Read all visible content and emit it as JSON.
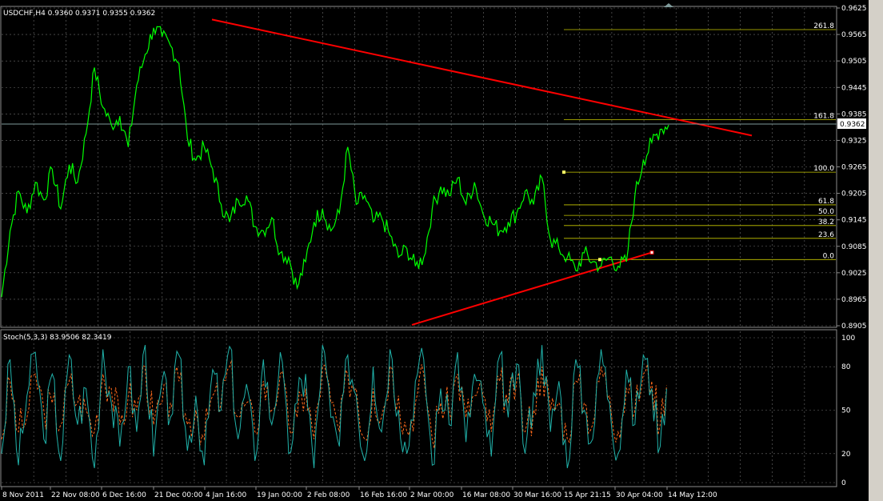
{
  "window": {
    "price_title": "USDCHF,H4  0.9360 0.9371 0.9355 0.9362",
    "osc_title": "Stoch(5,3,3) 83.9506 82.3419"
  },
  "colors": {
    "background": "#000000",
    "grid": "#6e6e6e",
    "price_line": "#00ff00",
    "trendline": "#ff0000",
    "fibo": "#c8c800",
    "bid_line": "#7f9a9a",
    "stoch_main": "#20b2aa",
    "stoch_signal": "#ff6a1a",
    "axis_text": "#ffffff"
  },
  "chart_data": [
    {
      "type": "line",
      "name": "price",
      "ylim": [
        0.8905,
        0.9625
      ],
      "y_ticks": [
        "0.9625",
        "0.9565",
        "0.9505",
        "0.9445",
        "0.9385",
        "0.9325",
        "0.9265",
        "0.9205",
        "0.9145",
        "0.9085",
        "0.9025",
        "0.8965",
        "0.8905"
      ],
      "current_price": "0.9362",
      "x_ticks": [
        "8 Nov 2011",
        "22 Nov 08:00",
        "6 Dec 16:00",
        "21 Dec 00:00",
        "4 Jan 16:00",
        "19 Jan 00:00",
        "2 Feb 08:00",
        "16 Feb 16:00",
        "2 Mar 00:00",
        "16 Mar 08:00",
        "30 Mar 16:00",
        "15 Apr 21:15",
        "30 Apr 04:00",
        "14 May 12:00"
      ],
      "series": [
        {
          "values": [
            0.897,
            0.912,
            0.921,
            0.916,
            0.923,
            0.919,
            0.926,
            0.917,
            0.927,
            0.923,
            0.934,
            0.949,
            0.94,
            0.936,
            0.938,
            0.931,
            0.945,
            0.952,
            0.958,
            0.956,
            0.954,
            0.95,
            0.933,
            0.928,
            0.931,
            0.926,
            0.918,
            0.914,
            0.919,
            0.92,
            0.913,
            0.912,
            0.915,
            0.907,
            0.906,
            0.899,
            0.905,
            0.914,
            0.917,
            0.912,
            0.916,
            0.931,
            0.918,
            0.92,
            0.914,
            0.915,
            0.911,
            0.906,
            0.908,
            0.904,
            0.906,
            0.917,
            0.922,
            0.92,
            0.924,
            0.918,
            0.923,
            0.916,
            0.914,
            0.912,
            0.914,
            0.916,
            0.921,
            0.918,
            0.924,
            0.91,
            0.908,
            0.906,
            0.903,
            0.907,
            0.905,
            0.904,
            0.906,
            0.904,
            0.905,
            0.92,
            0.928,
            0.932,
            0.935,
            0.936
          ]
        }
      ],
      "trendlines": [
        {
          "from": [
            0.22,
            0.9599
          ],
          "to": [
            0.79,
            0.9336
          ]
        },
        {
          "from": [
            0.43,
            0.8907
          ],
          "to": [
            0.68,
            0.9071
          ]
        }
      ],
      "fibonacci": {
        "x_start": 0.59,
        "x_end": 0.87,
        "levels": [
          {
            "label": "261.8",
            "price": 0.9576
          },
          {
            "label": "161.8",
            "price": 0.9372
          },
          {
            "label": "100.0",
            "price": 0.9253
          },
          {
            "label": "61.8",
            "price": 0.9179
          },
          {
            "label": "50.0",
            "price": 0.9155
          },
          {
            "label": "38.2",
            "price": 0.9132
          },
          {
            "label": "23.6",
            "price": 0.9103
          },
          {
            "label": "0.0",
            "price": 0.9055
          }
        ]
      }
    },
    {
      "type": "line",
      "name": "stochastic",
      "ylim": [
        0,
        100
      ],
      "y_ticks": [
        "100",
        "80",
        "50",
        "20",
        "0"
      ],
      "series": [
        {
          "name": "main",
          "values": [
            20,
            85,
            12,
            60,
            90,
            30,
            75,
            15,
            88,
            40,
            65,
            10,
            92,
            55,
            25,
            80,
            35,
            95,
            18,
            70,
            45,
            88,
            22,
            60,
            12,
            78,
            50,
            94,
            30,
            68,
            15,
            85,
            40,
            90,
            20,
            55,
            75,
            10,
            95,
            45,
            25,
            88,
            60,
            15,
            80,
            35,
            92,
            50,
            20,
            70,
            85,
            12,
            65,
            40,
            90,
            28,
            75,
            55,
            18,
            88,
            45,
            82,
            20,
            62,
            95,
            35,
            70,
            10,
            85,
            50,
            30,
            92,
            55,
            20,
            78,
            40,
            88,
            65,
            25,
            84
          ]
        },
        {
          "name": "signal",
          "values": [
            30,
            70,
            35,
            45,
            75,
            50,
            55,
            40,
            70,
            55,
            50,
            35,
            75,
            65,
            40,
            60,
            50,
            80,
            40,
            55,
            55,
            70,
            40,
            50,
            30,
            60,
            55,
            80,
            45,
            55,
            35,
            70,
            50,
            75,
            40,
            45,
            65,
            30,
            80,
            55,
            35,
            75,
            65,
            30,
            65,
            45,
            80,
            60,
            35,
            55,
            75,
            30,
            55,
            50,
            75,
            45,
            60,
            60,
            35,
            70,
            55,
            70,
            35,
            50,
            80,
            50,
            55,
            30,
            70,
            55,
            40,
            80,
            60,
            35,
            65,
            50,
            75,
            70,
            40,
            82
          ]
        }
      ]
    }
  ]
}
